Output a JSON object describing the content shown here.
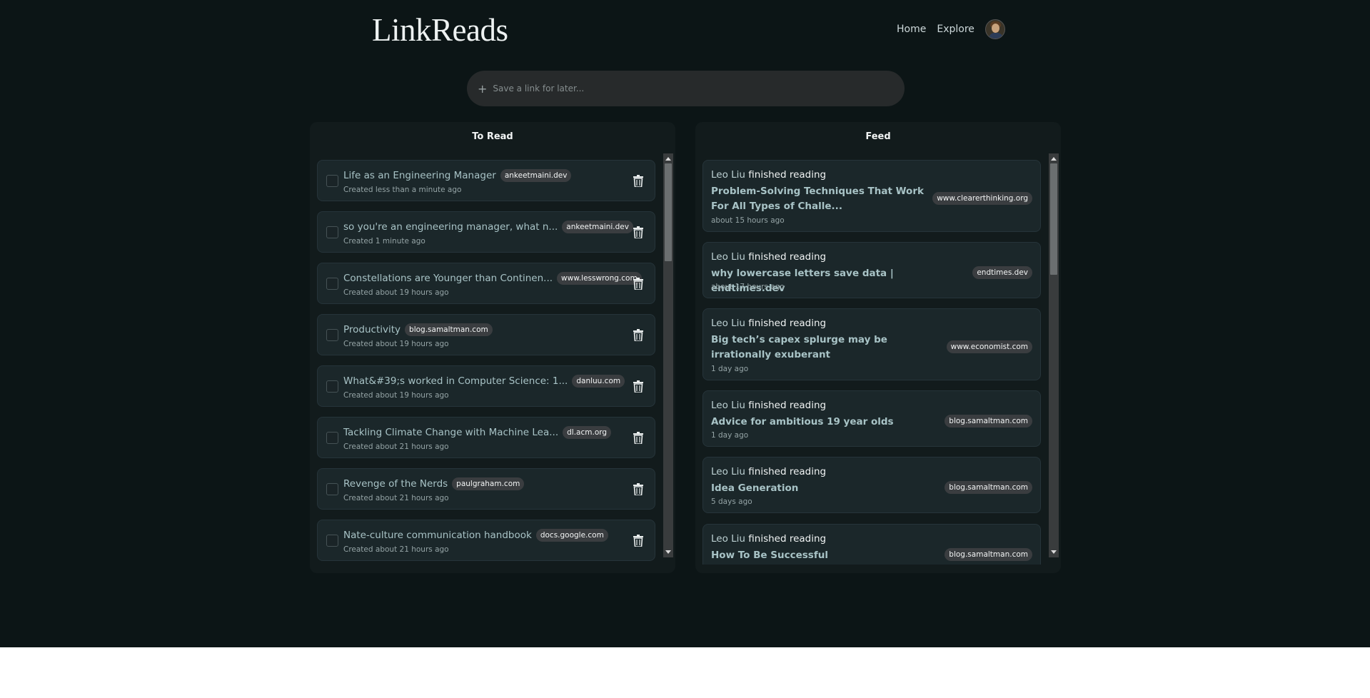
{
  "header": {
    "logo": "LinkReads",
    "nav": [
      "Home",
      "Explore"
    ]
  },
  "save_bar": {
    "icon": "plus-icon",
    "placeholder": "Save a link for later..."
  },
  "to_read": {
    "title": "To Read",
    "items": [
      {
        "title": "Life as an Engineering Manager",
        "domain": "ankeetmaini.dev",
        "created": "Created less than a minute ago"
      },
      {
        "title": "so you're an engineering manager, what n...",
        "domain": "ankeetmaini.dev",
        "created": "Created 1 minute ago"
      },
      {
        "title": "Constellations are Younger than Continen...",
        "domain": "www.lesswrong.com",
        "created": "Created about 19 hours ago"
      },
      {
        "title": "Productivity",
        "domain": "blog.samaltman.com",
        "created": "Created about 19 hours ago"
      },
      {
        "title": "What&#39;s worked in Computer Science: 1...",
        "domain": "danluu.com",
        "created": "Created about 19 hours ago"
      },
      {
        "title": "Tackling Climate Change with Machine Lea...",
        "domain": "dl.acm.org",
        "created": "Created about 21 hours ago"
      },
      {
        "title": "Revenge of the Nerds",
        "domain": "paulgraham.com",
        "created": "Created about 21 hours ago"
      },
      {
        "title": "Nate-culture communication handbook",
        "domain": "docs.google.com",
        "created": "Created about 21 hours ago"
      }
    ]
  },
  "feed": {
    "title": "Feed",
    "items": [
      {
        "user": "Leo Liu",
        "action": "finished reading",
        "title": "Problem-Solving Techniques That Work For All Types of Challe...",
        "domain": "www.clearerthinking.org",
        "time": "about 15 hours ago"
      },
      {
        "user": "Leo Liu",
        "action": "finished reading",
        "title": "why lowercase letters save data | endtimes.dev",
        "domain": "endtimes.dev",
        "time": "about 17 hours ago"
      },
      {
        "user": "Leo Liu",
        "action": "finished reading",
        "title": "Big tech’s capex splurge may be irrationally exuberant",
        "domain": "www.economist.com",
        "time": "1 day ago"
      },
      {
        "user": "Leo Liu",
        "action": "finished reading",
        "title": "Advice for ambitious 19 year olds",
        "domain": "blog.samaltman.com",
        "time": "1 day ago"
      },
      {
        "user": "Leo Liu",
        "action": "finished reading",
        "title": "Idea Generation",
        "domain": "blog.samaltman.com",
        "time": "5 days ago"
      },
      {
        "user": "Leo Liu",
        "action": "finished reading",
        "title": "How To Be Successful",
        "domain": "blog.samaltman.com",
        "time": ""
      }
    ]
  },
  "colors": {
    "background": "#0c1516",
    "panel": "#121b1c",
    "card": "#1b272a",
    "link": "#a8c3c6",
    "badge": "#3a3d40"
  }
}
